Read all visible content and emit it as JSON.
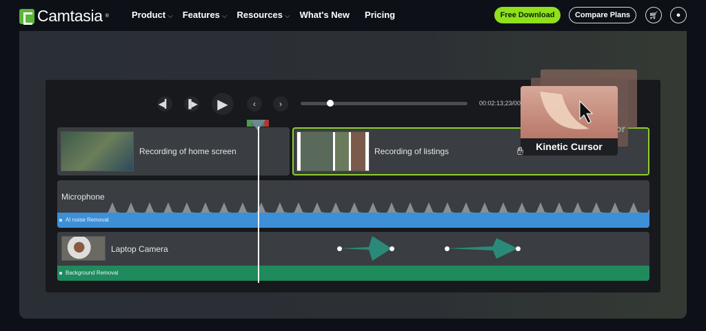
{
  "nav": {
    "brand": "Camtasia",
    "brand_mark": "®",
    "menu": [
      {
        "label": "Product",
        "dropdown": true
      },
      {
        "label": "Features",
        "dropdown": true
      },
      {
        "label": "Resources",
        "dropdown": true
      },
      {
        "label": "What's New",
        "dropdown": false
      },
      {
        "label": "Pricing",
        "dropdown": false
      }
    ],
    "free_download": "Free Download",
    "compare_plans": "Compare Plans",
    "icons": [
      "cart-icon",
      "user-icon"
    ]
  },
  "player": {
    "timecode": "00:02:13;23/00",
    "progress_percent": 16
  },
  "tracks": {
    "video": [
      {
        "label": "Recording of home screen"
      },
      {
        "label": "Recording of listings",
        "selected": true
      }
    ],
    "microphone": {
      "label": "Microphone",
      "effect": "AI noise Removal",
      "effect_color": "#3d8fd6"
    },
    "camera": {
      "label": "Laptop Camera",
      "effect": "Background Removal",
      "effect_color": "#1f8a5c"
    }
  },
  "kinetic_cursor": {
    "label": "Kinetic Cursor",
    "behind_label_fragment": "or"
  },
  "colors": {
    "accent": "#8fe11c",
    "selected_border": "#8fd129",
    "animation_arrow": "#2a8a78"
  }
}
